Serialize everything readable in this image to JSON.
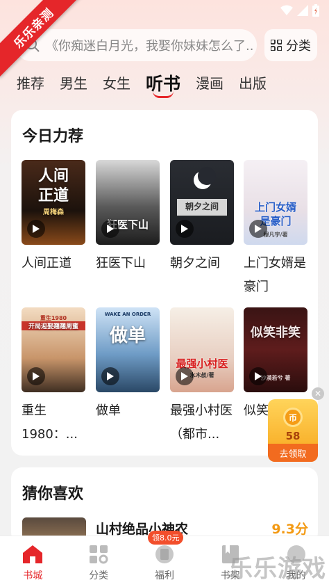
{
  "watermark": {
    "corner": "乐乐亲测",
    "bottom": "乐乐游戏"
  },
  "search": {
    "placeholder": "《你痴迷白月光，我娶你妹妹怎么了..."
  },
  "header": {
    "category_label": "分类"
  },
  "tabs": [
    {
      "label": "推荐"
    },
    {
      "label": "男生"
    },
    {
      "label": "女生"
    },
    {
      "label": "听书",
      "active": true
    },
    {
      "label": "漫画"
    },
    {
      "label": "出版"
    }
  ],
  "today": {
    "title": "今日力荐",
    "books": [
      {
        "title": "人间正道",
        "cover_text": "人间\n正道",
        "cover_sub": "周梅森"
      },
      {
        "title": "狂医下山",
        "cover_text": "狂医下山"
      },
      {
        "title": "朝夕之间",
        "cover_text": "朝夕之间"
      },
      {
        "title": "上门女婿是豪门",
        "cover_text": "上门女婿\n是豪门",
        "cover_sub": "穆凡宇/著"
      },
      {
        "title": "重生1980：...",
        "cover_text": "开局迎娶翘翘周蜜",
        "cover_sub": "重生1980"
      },
      {
        "title": "做单",
        "cover_text": "做单",
        "cover_sub": "WAKE AN ORDER"
      },
      {
        "title": "最强小村医（都市...",
        "cover_text": "最强小村医",
        "cover_sub": "水木叔/著"
      },
      {
        "title": "似笑",
        "cover_text": "似笑非笑",
        "cover_sub": "沙漠若兮 著"
      }
    ]
  },
  "guess": {
    "title": "猜你喜欢",
    "item": {
      "title": "山村绝品小神农",
      "score": "9.3分"
    }
  },
  "float_reward": {
    "amount": "58",
    "label": "去领取"
  },
  "bottom_nav": [
    {
      "label": "书城",
      "active": true
    },
    {
      "label": "分类"
    },
    {
      "label": "福利",
      "badge": "领8.0元"
    },
    {
      "label": "书架"
    },
    {
      "label": "我的"
    }
  ],
  "colors": {
    "accent": "#e5262a",
    "score": "#f39a14"
  }
}
